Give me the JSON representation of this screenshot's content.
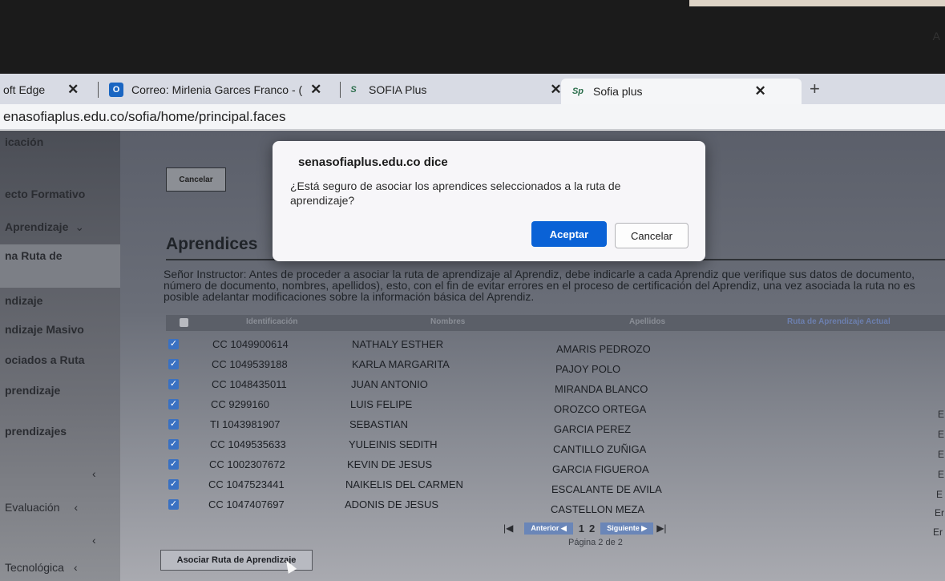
{
  "browser": {
    "tabs": [
      {
        "label": "oft Edge"
      },
      {
        "label": "Correo: Mirlenia Garces Franco - ("
      },
      {
        "label": "SOFIA Plus"
      },
      {
        "label": "Sofia plus",
        "active": true
      }
    ],
    "url": "enasofiaplus.edu.co/sofia/home/principal.faces",
    "reader_icon": "A"
  },
  "sidebar": {
    "items": [
      {
        "label": "icación"
      },
      {
        "label": "ecto Formativo"
      },
      {
        "label": "Aprendizaje"
      },
      {
        "label": "na Ruta de"
      },
      {
        "label": "ndizaje"
      },
      {
        "label": "ndizaje Masivo"
      },
      {
        "label": "ociados a Ruta"
      },
      {
        "label": "prendizaje"
      },
      {
        "label": "prendizajes"
      },
      {
        "label": "Evaluación"
      },
      {
        "label": "Tecnológica"
      }
    ]
  },
  "main": {
    "cancel_label": "Cancelar",
    "heading": "Aprendices",
    "notice": "Señor Instructor: Antes de proceder a asociar la ruta de aprendizaje al Aprendiz, debe indicarle a cada Aprendiz que verifique sus datos de documento, número de documento, nombres, apellidos), esto, con el fin de evitar errores en el proceso de certificación del Aprendiz, una vez asociada la ruta no es posible adelantar modificaciones sobre la información básica del Aprendiz.",
    "table": {
      "headers": [
        "Identificación",
        "Nombres",
        "Apellidos",
        "Ruta de Aprendizaje Actual"
      ],
      "rows": [
        {
          "id": "CC 1049900614",
          "nombres": "NATHALY ESTHER",
          "apellidos": "AMARIS PEDROZO",
          "checked": true
        },
        {
          "id": "CC 1049539188",
          "nombres": "KARLA MARGARITA",
          "apellidos": "PAJOY POLO",
          "checked": true
        },
        {
          "id": "CC 1048435011",
          "nombres": "JUAN ANTONIO",
          "apellidos": "MIRANDA BLANCO",
          "checked": true
        },
        {
          "id": "CC 9299160",
          "nombres": "LUIS FELIPE",
          "apellidos": "OROZCO ORTEGA",
          "checked": true
        },
        {
          "id": "TI 1043981907",
          "nombres": "SEBASTIAN",
          "apellidos": "GARCIA PEREZ",
          "checked": true
        },
        {
          "id": "CC 1049535633",
          "nombres": "YULEINIS SEDITH",
          "apellidos": "CANTILLO ZUÑIGA",
          "checked": true
        },
        {
          "id": "CC 1002307672",
          "nombres": "KEVIN DE JESUS",
          "apellidos": "GARCIA FIGUEROA",
          "checked": true
        },
        {
          "id": "CC 1047523441",
          "nombres": "NAIKELIS DEL CARMEN",
          "apellidos": "ESCALANTE DE AVILA",
          "checked": true
        },
        {
          "id": "CC 1047407697",
          "nombres": "ADONIS DE JESUS",
          "apellidos": "CASTELLON MEZA",
          "checked": true
        }
      ],
      "edge_marks": [
        "E",
        "E",
        "E",
        "E",
        "E",
        "Er",
        "Er"
      ]
    },
    "pager": {
      "first": "|◀",
      "prev": "Anterior ◀",
      "pages": [
        "1",
        "2"
      ],
      "next": "Siguiente ▶",
      "last": "▶|",
      "info": "Página 2 de 2"
    },
    "associate_button": "Asociar Ruta de Aprendizaje"
  },
  "dialog": {
    "title": "senasofiaplus.edu.co dice",
    "message": "¿Está seguro de asociar los aprendices seleccionados a la ruta de aprendizaje?",
    "ok_label": "Aceptar",
    "cancel_label": "Cancelar",
    "ok_color": "#0a62d6"
  }
}
